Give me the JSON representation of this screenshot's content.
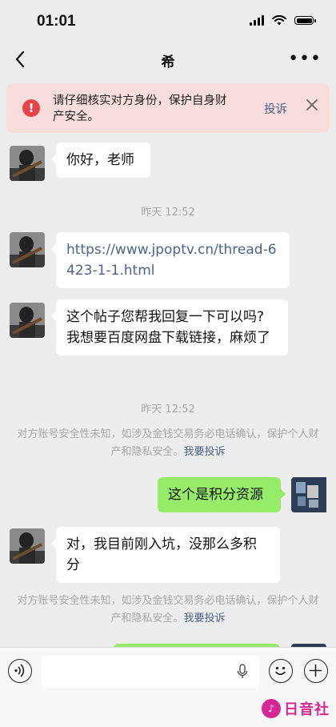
{
  "status_bar": {
    "time": "01:01"
  },
  "nav": {
    "title": "希"
  },
  "warning": {
    "text": "请仔细核实对方身份，保护自身财产安全。",
    "report_label": "投诉"
  },
  "messages": {
    "m1": "你好，老师",
    "ts1": "昨天 12:52",
    "m2": "https://www.jpoptv.cn/thread-6423-1-1.html",
    "m3": "这个帖子您帮我回复一下可以吗?我想要百度网盘下载链接，麻烦了",
    "ts2": "昨天 12:52",
    "sys1_text": "对方账号安全性未知，如涉及金钱交易务必电话确认，保护个人财产和隐私安全。",
    "sys1_link": "我要投诉",
    "m4": "这个是积分资源",
    "m5": "对，我目前刚入坑，没那么多积分",
    "sys2_text": "对方账号安全性未知，如涉及金钱交易务必电话确认，保护个人财产和隐私安全。",
    "sys2_link": "我要投诉"
  },
  "watermark": {
    "text": "日音社",
    "logo": "♪"
  },
  "colors": {
    "accent_green": "#95ec69",
    "link_blue": "#4b638a",
    "warning_bg": "#f9dcdc",
    "warning_red": "#e5454a"
  }
}
